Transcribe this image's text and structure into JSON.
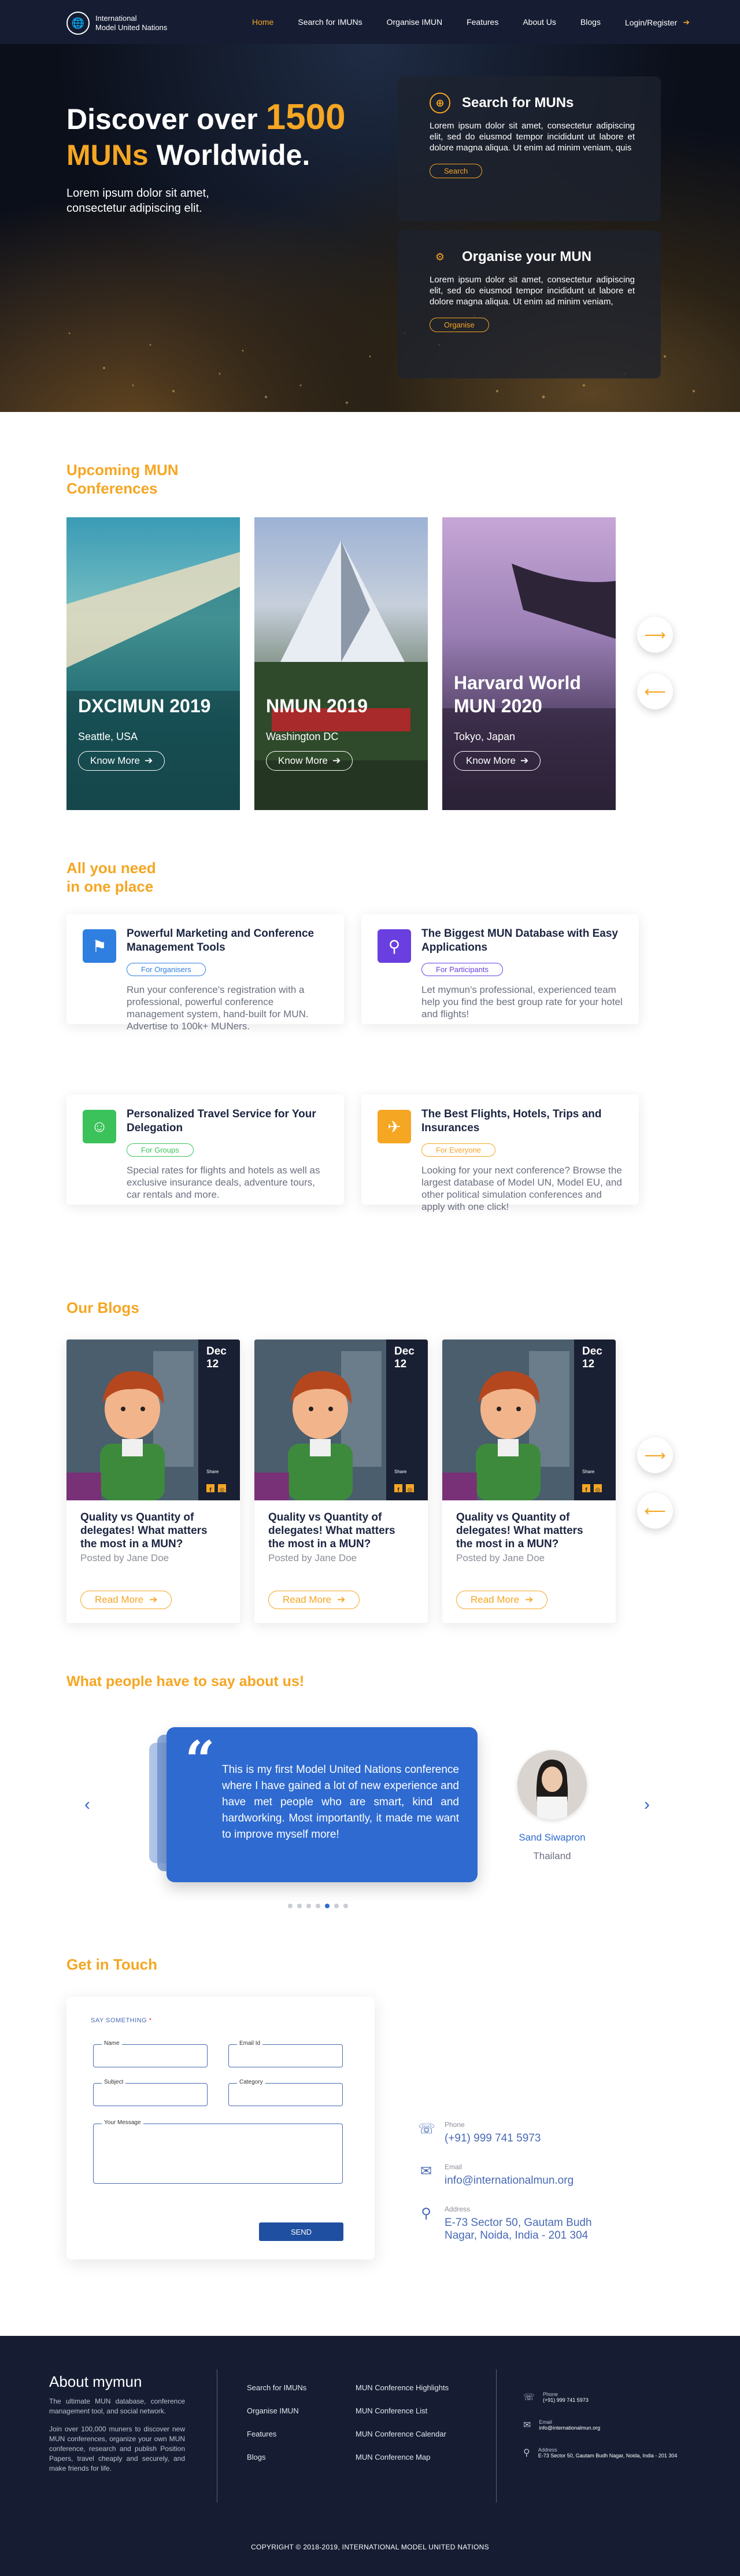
{
  "colors": {
    "accent": "#f5a623",
    "navy": "#161d33",
    "blue": "#2e6ad0"
  },
  "nav": {
    "logo_line1": "International",
    "logo_line2": "Model United Nations",
    "items": [
      "Home",
      "Search for IMUNs",
      "Organise IMUN",
      "Features",
      "About Us",
      "Blogs"
    ],
    "login": "Login/Register"
  },
  "hero": {
    "title_part1": "Discover over",
    "title_highlight1": "1500",
    "title_highlight2": "MUNs",
    "title_part2": "Worldwide.",
    "subtitle": "Lorem ipsum dolor sit amet, consectetur adipiscing elit.",
    "cards": [
      {
        "title": "Search for MUNs",
        "icon": "globe-search-icon",
        "text": "Lorem ipsum dolor sit amet, consectetur adipiscing elit, sed do eiusmod tempor incididunt ut labore et dolore magna aliqua. Ut enim ad minim veniam, quis",
        "button": "Search"
      },
      {
        "title": "Organise your MUN",
        "icon": "organise-icon",
        "text": "Lorem ipsum dolor sit amet, consectetur adipiscing elit, sed do eiusmod tempor incididunt ut labore et dolore magna aliqua. Ut enim ad minim veniam,",
        "button": "Organise"
      }
    ]
  },
  "upcoming": {
    "title_line1": "Upcoming MUN",
    "title_line2": "Conferences",
    "cards": [
      {
        "name": "DXCIMUN 2019",
        "place": "Seattle, USA",
        "button": "Know More"
      },
      {
        "name": "NMUN 2019",
        "place": "Washington DC",
        "button": "Know More"
      },
      {
        "name": "Harvard World MUN 2020",
        "place": "Tokyo, Japan",
        "button": "Know More"
      }
    ]
  },
  "features": {
    "title_line1": "All you need",
    "title_line2": "in one place",
    "items": [
      {
        "title": "Powerful Marketing and Conference Management Tools",
        "tag": "For Organisers",
        "icon": "marketing-icon",
        "color": "#2f7fe0",
        "text": "Run your conference's registration with a professional, powerful conference management system, hand-built for MUN. Advertise to 100k+ MUNers."
      },
      {
        "title": "The Biggest MUN Database with Easy Applications",
        "tag": "For Participants",
        "icon": "database-icon",
        "color": "#6a3fe0",
        "text": "Let mymun's professional, experienced team help you find the best group rate for your hotel and flights!"
      },
      {
        "title": "Personalized Travel Service for Your Delegation",
        "tag": "For Groups",
        "icon": "travel-icon",
        "color": "#3cc25a",
        "text": "Special rates for flights and hotels as well as exclusive insurance deals, adventure tours, car rentals and more."
      },
      {
        "title": "The Best Flights, Hotels, Trips and Insurances",
        "tag": "For Everyone",
        "icon": "flight-icon",
        "color": "#f5a623",
        "text": "Looking for your next conference? Browse the largest database of Model UN, Model EU, and other political simulation conferences and apply with one click!"
      }
    ]
  },
  "blogs": {
    "title": "Our Blogs",
    "items": [
      {
        "month": "Dec",
        "day": "12",
        "share": "Share",
        "title": "Quality vs Quantity of delegates! What matters the most in a MUN?",
        "by": "Posted by Jane Doe",
        "button": "Read More"
      },
      {
        "month": "Dec",
        "day": "12",
        "share": "Share",
        "title": "Quality vs Quantity of delegates! What matters the most in a MUN?",
        "by": "Posted by Jane Doe",
        "button": "Read More"
      },
      {
        "month": "Dec",
        "day": "12",
        "share": "Share",
        "title": "Quality vs Quantity of delegates! What matters the most in a MUN?",
        "by": "Posted by Jane Doe",
        "button": "Read More"
      }
    ]
  },
  "testimonials": {
    "title": "What people have to say about us!",
    "quote": "This is my first Model United Nations conference where I have gained a lot of new experience and have met people who are smart, kind and hardworking. Most importantly, it made me want to improve myself more!",
    "name": "Sand Siwapron",
    "country": "Thailand"
  },
  "contact": {
    "title": "Get in Touch",
    "form": {
      "heading": "SAY SOMETHING",
      "name": "Name",
      "email": "Email Id",
      "subject": "Subject",
      "category": "Category",
      "message": "Your Message",
      "submit": "SEND"
    },
    "phone_label": "Phone",
    "phone": "(+91) 999 741 5973",
    "email_label": "Email",
    "email": "info@internationalmun.org",
    "address_label": "Address",
    "address": "E-73 Sector 50, Gautam Budh Nagar, Noida, India - 201 304"
  },
  "footer": {
    "about_title": "About mymun",
    "about_p1": "The ultimate MUN database, conference management tool, and social network.",
    "about_p2": "Join over 100,000 muners to discover new MUN conferences, organize your own MUN conference, research and publish Position Papers, travel cheaply and securely, and make friends for life.",
    "col1": [
      "Search for IMUNs",
      "Organise IMUN",
      "Features",
      "Blogs"
    ],
    "col2": [
      "MUN Conference Highlights",
      "MUN Conference List",
      "MUN Conference Calendar",
      "MUN Conference Map"
    ],
    "phone_label": "Phone",
    "phone": "(+91) 999 741 5973",
    "email_label": "Email",
    "email": "info@internationalmun.org",
    "address_label": "Address",
    "address": "E-73 Sector 50, Gautam Budh Nagar, Noida, India - 201 304",
    "copyright": "COPYRIGHT © 2018-2019, INTERNATIONAL MODEL UNITED NATIONS"
  }
}
